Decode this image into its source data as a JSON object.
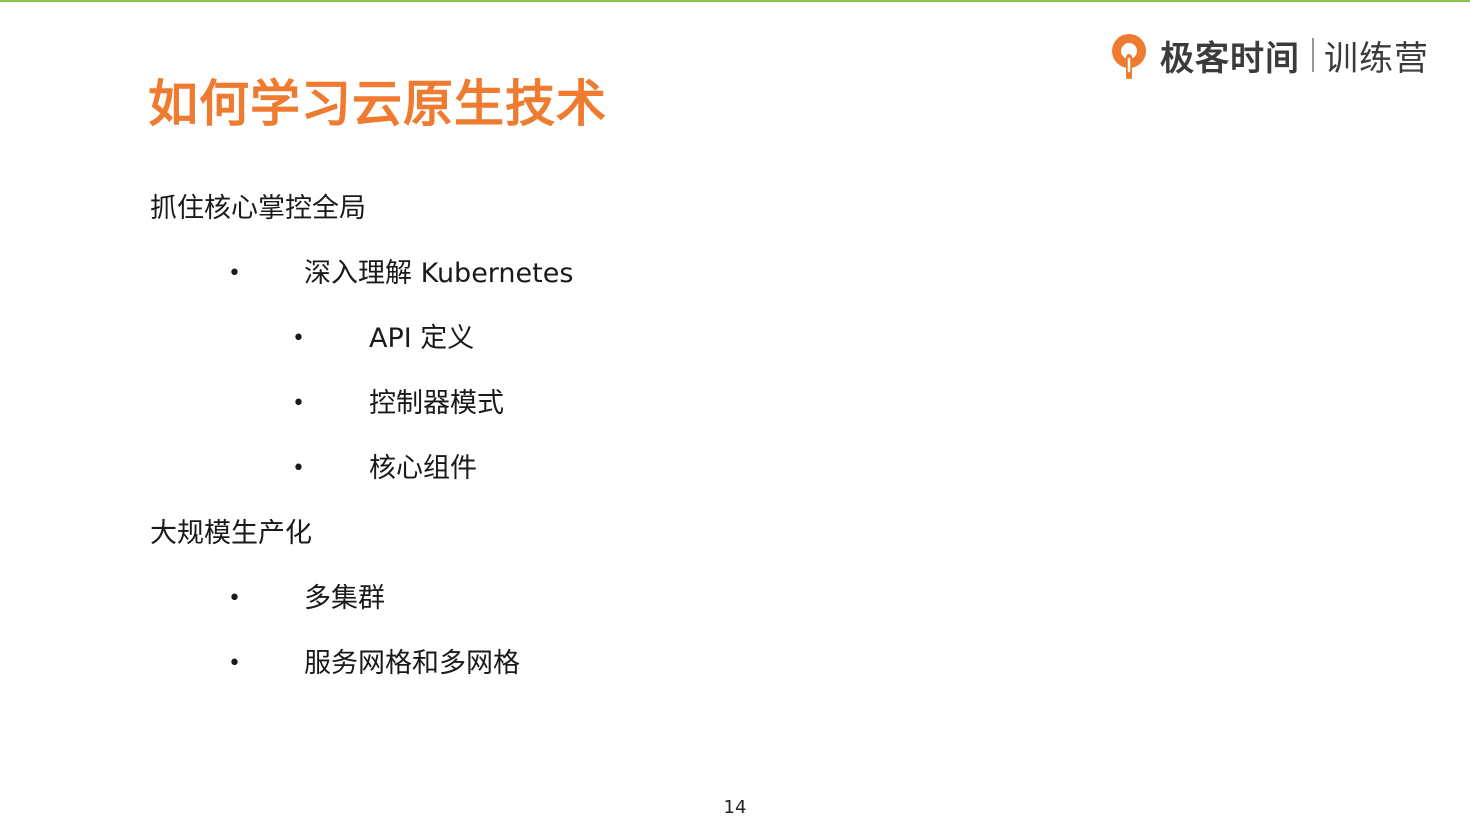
{
  "slide": {
    "title": "如何学习云原生技术",
    "page_number": "14"
  },
  "logo": {
    "brand": "极客时间",
    "sub": "训练营",
    "icon": "geektime-logo-icon",
    "color": "#ee7b2f"
  },
  "sections": [
    {
      "heading": "抓住核心掌控全局",
      "items": [
        {
          "text": "深入理解 Kubernetes",
          "children": [
            "API 定义",
            "控制器模式",
            "核心组件"
          ]
        }
      ]
    },
    {
      "heading": "大规模生产化",
      "items": [
        {
          "text": "多集群"
        },
        {
          "text": "服务网格和多网格"
        }
      ]
    }
  ],
  "colors": {
    "title": "#ee7b2f",
    "top_border": "#8bc34a"
  }
}
